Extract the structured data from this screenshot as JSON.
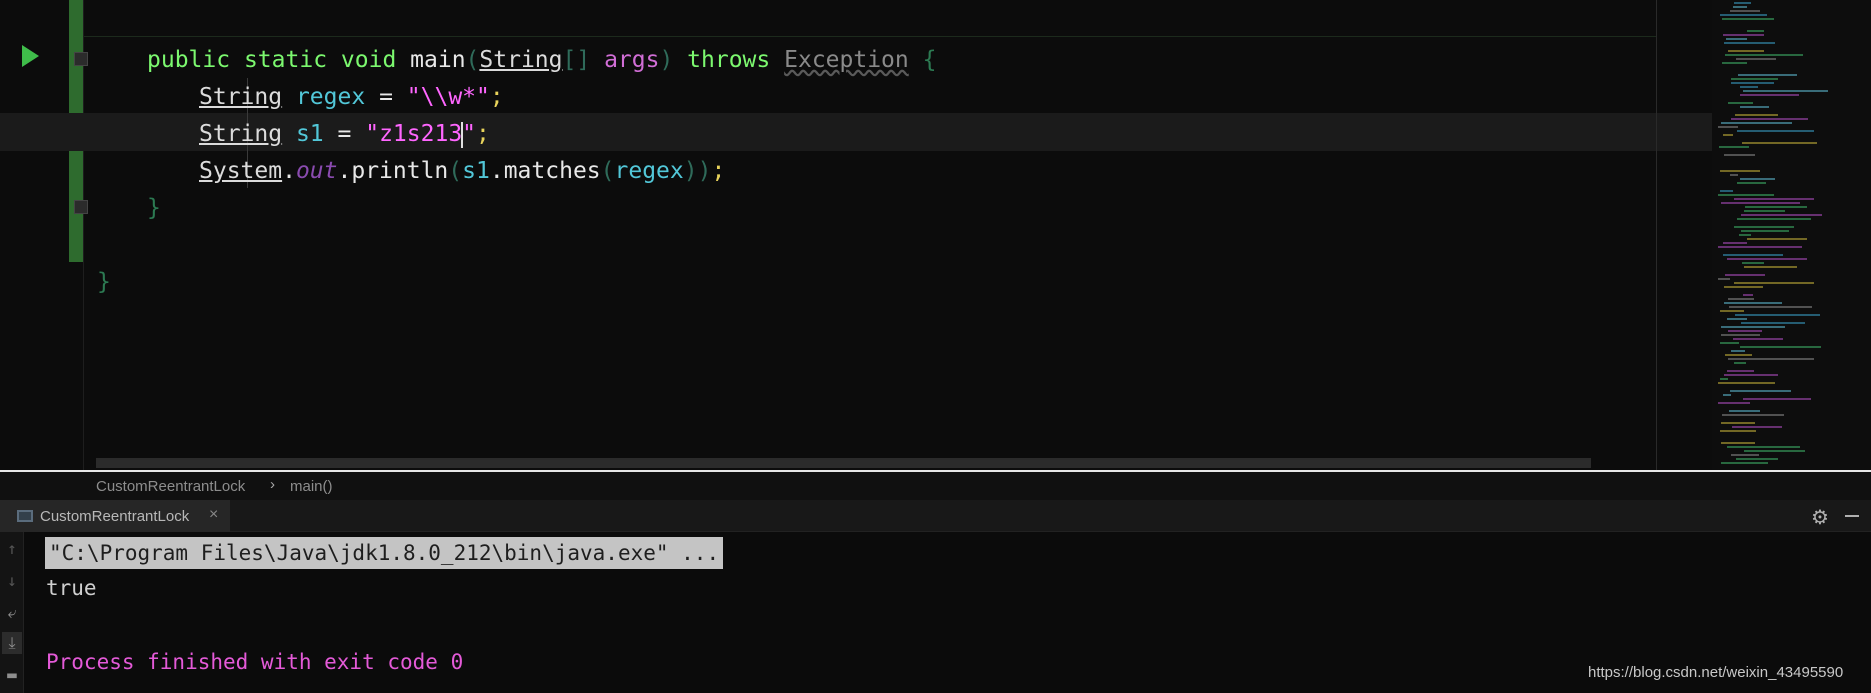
{
  "editor": {
    "line1": {
      "kw_public": "public",
      "kw_static": "static",
      "kw_void": "void",
      "method": "main",
      "lparen": "(",
      "type": "String",
      "brackets": "[]",
      "param": "args",
      "rparen": ")",
      "kw_throws": "throws",
      "exception": "Exception",
      "lbrace": "{"
    },
    "line2": {
      "type": "String",
      "var": "regex",
      "eq": "=",
      "str": "\"\\\\w*\"",
      "semi": ";"
    },
    "line3": {
      "type": "String",
      "var": "s1",
      "eq": "=",
      "str_a": "\"z1s213",
      "str_b": "\"",
      "semi": ";"
    },
    "line4": {
      "cls": "System",
      "dot1": ".",
      "field": "out",
      "call": ".println",
      "lparen": "(",
      "var": "s1",
      "dot2": ".",
      "method": "matches",
      "lparen2": "(",
      "arg": "regex",
      "rparen": "))",
      "semi": ";"
    },
    "line5": {
      "rbrace": "}"
    },
    "line6": {
      "rbrace": "}"
    }
  },
  "breadcrumb": {
    "class_name": "CustomReentrantLock",
    "separator": "›",
    "method_name": "main()"
  },
  "run_window": {
    "tab_label": "CustomReentrantLock",
    "tab_close": "×",
    "settings_glyph": "⚙",
    "command": "\"C:\\Program Files\\Java\\jdk1.8.0_212\\bin\\java.exe\" ...",
    "output": "true",
    "exit_message": "Process finished with exit code 0"
  },
  "side_toolbar": {
    "up": "↑",
    "down": "↓",
    "wrap": "⤶",
    "scroll": "⤓",
    "print": "▬"
  },
  "watermark": "https://blog.csdn.net/weixin_43495590",
  "colors": {
    "keyword": "#7cf86f",
    "parameter": "#d16ed6",
    "variable": "#52c7d8",
    "string": "#ff66ff",
    "exit_message": "#e45ad8",
    "run_icon": "#3fbd4a"
  },
  "icons": [
    "run-icon",
    "fold-icon",
    "console-icon",
    "close-icon",
    "gear-icon",
    "minimize-icon",
    "up-arrow-icon",
    "down-arrow-icon",
    "soft-wrap-icon",
    "scroll-to-end-icon",
    "print-icon"
  ]
}
